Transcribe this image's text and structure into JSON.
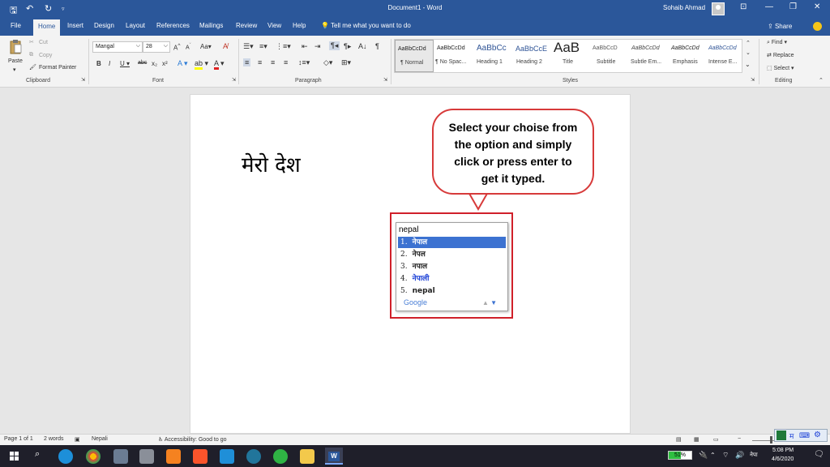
{
  "titlebar": {
    "doc_title": "Document1 - Word",
    "user": "Sohaib Ahmad"
  },
  "tabs": [
    "File",
    "Home",
    "Insert",
    "Design",
    "Layout",
    "References",
    "Mailings",
    "Review",
    "View",
    "Help"
  ],
  "tell_me": "Tell me what you want to do",
  "share": "Share",
  "clipboard": {
    "paste": "Paste",
    "cut": "Cut",
    "copy": "Copy",
    "format_painter": "Format Painter",
    "label": "Clipboard"
  },
  "font": {
    "name": "Mangal",
    "size": "28",
    "label": "Font"
  },
  "paragraph": {
    "label": "Paragraph"
  },
  "styles": {
    "label": "Styles",
    "items": [
      {
        "sample": "AaBbCcDd",
        "name": "¶ Normal"
      },
      {
        "sample": "AaBbCcDd",
        "name": "¶ No Spac..."
      },
      {
        "sample": "AaBbCc",
        "name": "Heading 1"
      },
      {
        "sample": "AaBbCcE",
        "name": "Heading 2"
      },
      {
        "sample": "AaB",
        "name": "Title"
      },
      {
        "sample": "AaBbCcD",
        "name": "Subtitle"
      },
      {
        "sample": "AaBbCcDd",
        "name": "Subtle Em..."
      },
      {
        "sample": "AaBbCcDd",
        "name": "Emphasis"
      },
      {
        "sample": "AaBbCcDd",
        "name": "Intense E..."
      }
    ]
  },
  "editing": {
    "find": "Find",
    "replace": "Replace",
    "select": "Select",
    "label": "Editing"
  },
  "document": {
    "text": "मेरो देश"
  },
  "callout": {
    "text": "Select your choise from the option and simply click or press enter to get it typed."
  },
  "ime": {
    "input": "nepal",
    "candidates": [
      {
        "num": "1.",
        "word": "नेपाल"
      },
      {
        "num": "2.",
        "word": "नेपल"
      },
      {
        "num": "3.",
        "word": "नपाल"
      },
      {
        "num": "4.",
        "word": "नेपाली"
      },
      {
        "num": "5.",
        "word": "nepal"
      }
    ],
    "brand": "Google"
  },
  "status": {
    "page": "Page 1 of 1",
    "words": "2 words",
    "language": "Nepali",
    "accessibility": "Accessibility: Good to go"
  },
  "taskbar": {
    "battery": "51%",
    "lang": "नेपा",
    "time": "5:08 PM",
    "date": "4/6/2020"
  },
  "colors": {
    "word_blue": "#2b579a",
    "callout_border": "#d73a3a",
    "highlight_red": "#d0202a",
    "candidate_selected": "#3c72d1",
    "candidate_4": "#1a3fd6"
  }
}
